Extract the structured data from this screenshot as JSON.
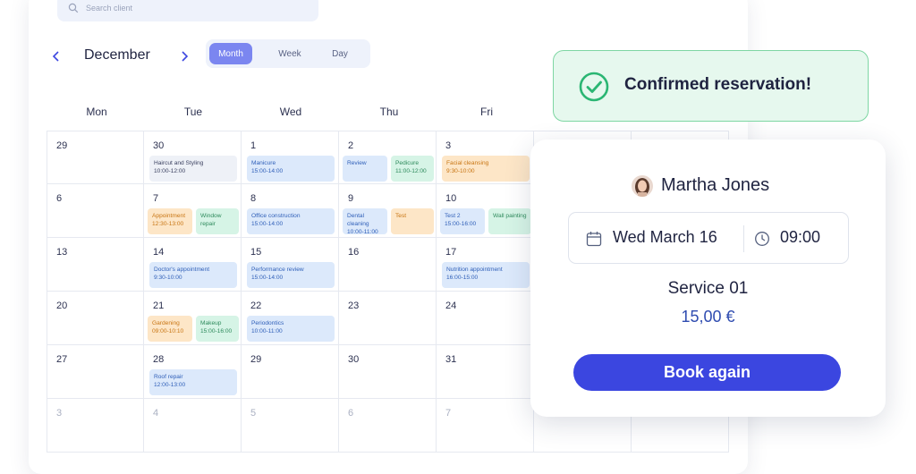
{
  "search": {
    "placeholder": "Search client"
  },
  "calendar": {
    "month": "December",
    "views": [
      "Month",
      "Week",
      "Day"
    ],
    "active_view": "Month",
    "weekdays": [
      "Mon",
      "Tue",
      "Wed",
      "Thu",
      "Fri"
    ],
    "weeks": [
      [
        {
          "day": "29",
          "muted": false,
          "events": []
        },
        {
          "day": "30",
          "muted": false,
          "events": [
            {
              "title": "Haircut and Styling",
              "time": "10:00-12:00",
              "color": "grey"
            }
          ]
        },
        {
          "day": "1",
          "muted": false,
          "events": [
            {
              "title": "Manicure",
              "time": "15:00-14:00",
              "color": "blue"
            }
          ]
        },
        {
          "day": "2",
          "muted": false,
          "events": [
            {
              "title": "Review",
              "time": "",
              "color": "blue"
            },
            {
              "title": "Pedicure",
              "time": "11:00-12:00",
              "color": "green"
            }
          ]
        },
        {
          "day": "3",
          "muted": false,
          "events": [
            {
              "title": "Facial cleansing",
              "time": "9:30-10:00",
              "color": "orange"
            }
          ]
        }
      ],
      [
        {
          "day": "6",
          "muted": false,
          "events": []
        },
        {
          "day": "7",
          "muted": false,
          "events": [
            {
              "title": "Appointment",
              "time": "12:30-13:00",
              "color": "orange"
            },
            {
              "title": "Window repair",
              "time": "",
              "color": "green"
            }
          ]
        },
        {
          "day": "8",
          "muted": false,
          "events": [
            {
              "title": "Office construction",
              "time": "15:00-14:00",
              "color": "blue"
            }
          ]
        },
        {
          "day": "9",
          "muted": false,
          "events": [
            {
              "title": "Dental cleaning",
              "time": "10:00-11:00",
              "color": "blue"
            },
            {
              "title": "Test",
              "time": "",
              "color": "orange"
            }
          ]
        },
        {
          "day": "10",
          "muted": false,
          "events": [
            {
              "title": "Test 2",
              "time": "15:00-16:00",
              "color": "blue"
            },
            {
              "title": "Wall painting",
              "time": "",
              "color": "green"
            }
          ]
        }
      ],
      [
        {
          "day": "13",
          "muted": false,
          "events": []
        },
        {
          "day": "14",
          "muted": false,
          "events": [
            {
              "title": "Doctor's appointment",
              "time": "9:30-10:00",
              "color": "blue"
            }
          ]
        },
        {
          "day": "15",
          "muted": false,
          "events": [
            {
              "title": "Performance review",
              "time": "15:00-14:00",
              "color": "blue"
            }
          ]
        },
        {
          "day": "16",
          "muted": false,
          "events": []
        },
        {
          "day": "17",
          "muted": false,
          "events": [
            {
              "title": "Nutrition appointment",
              "time": "16:00-15:00",
              "color": "blue"
            }
          ]
        }
      ],
      [
        {
          "day": "20",
          "muted": false,
          "events": []
        },
        {
          "day": "21",
          "muted": false,
          "events": [
            {
              "title": "Gardening",
              "time": "09:00-10:10",
              "color": "orange"
            },
            {
              "title": "Makeup",
              "time": "15:00-16:00",
              "color": "green"
            }
          ]
        },
        {
          "day": "22",
          "muted": false,
          "events": [
            {
              "title": "Periodontics",
              "time": "10:00-11:00",
              "color": "blue"
            }
          ]
        },
        {
          "day": "23",
          "muted": false,
          "events": []
        },
        {
          "day": "24",
          "muted": false,
          "events": []
        }
      ],
      [
        {
          "day": "27",
          "muted": false,
          "events": []
        },
        {
          "day": "28",
          "muted": false,
          "events": [
            {
              "title": "Roof repair",
              "time": "12:00-13:00",
              "color": "blue"
            }
          ]
        },
        {
          "day": "29",
          "muted": false,
          "events": []
        },
        {
          "day": "30",
          "muted": false,
          "events": []
        },
        {
          "day": "31",
          "muted": false,
          "events": []
        }
      ],
      [
        {
          "day": "3",
          "muted": true,
          "events": []
        },
        {
          "day": "4",
          "muted": true,
          "events": []
        },
        {
          "day": "5",
          "muted": true,
          "events": []
        },
        {
          "day": "6",
          "muted": true,
          "events": []
        },
        {
          "day": "7",
          "muted": true,
          "events": []
        }
      ]
    ]
  },
  "notification": {
    "text": "Confirmed reservation!"
  },
  "reservation": {
    "client_name": "Martha Jones",
    "date": "Wed March 16",
    "time": "09:00",
    "service": "Service 01",
    "price": "15,00 €",
    "book_again_label": "Book again"
  },
  "colors": {
    "accent": "#3b46e0",
    "view_active": "#7b86f0",
    "success": "#2bb673"
  }
}
